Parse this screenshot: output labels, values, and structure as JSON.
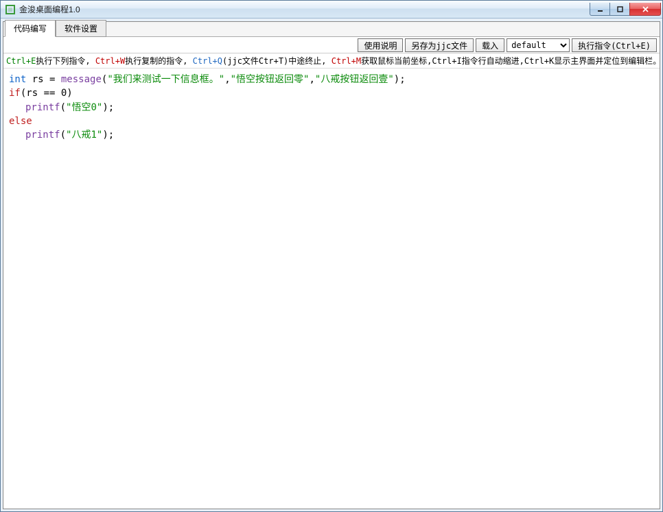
{
  "window": {
    "title": "金浚桌面编程1.0"
  },
  "tabs": [
    {
      "label": "代码编写",
      "active": true
    },
    {
      "label": "软件设置",
      "active": false
    }
  ],
  "toolbar": {
    "help_label": "使用说明",
    "saveas_label": "另存为jjc文件",
    "load_label": "载入",
    "select_value": "default",
    "run_label": "执行指令(Ctrl+E)"
  },
  "hints": {
    "h1_key": "Ctrl+E",
    "h1_txt": "执行下列指令,",
    "h2_key": "Ctrl+W",
    "h2_txt": "执行复制的指令,",
    "h3_key": "Ctrl+Q",
    "h3_txt": "(jjc文件Ctr+T)中途终止,",
    "h4_key": "Ctrl+M",
    "h4_txt": "获取鼠标当前坐标,Ctrl+I指令行自动缩进,Ctrl+K显示主界面并定位到编辑栏。"
  },
  "code": {
    "l1_type": "int",
    "l1_id": " rs = ",
    "l1_func": "message",
    "l1_p1": "(",
    "l1_s1": "\"我们来测试一下信息框。\"",
    "l1_c1": ",",
    "l1_s2": "\"悟空按钮返回零\"",
    "l1_c2": ",",
    "l1_s3": "\"八戒按钮返回壹\"",
    "l1_end": ");",
    "l2_kw": "if",
    "l2_cond": "(rs == 0)",
    "l3_func": "printf",
    "l3_p1": "(",
    "l3_s1": "\"悟空0\"",
    "l3_end": ");",
    "l4_kw": "else",
    "l5_func": "printf",
    "l5_p1": "(",
    "l5_s1": "\"八戒1\"",
    "l5_end": ");"
  }
}
